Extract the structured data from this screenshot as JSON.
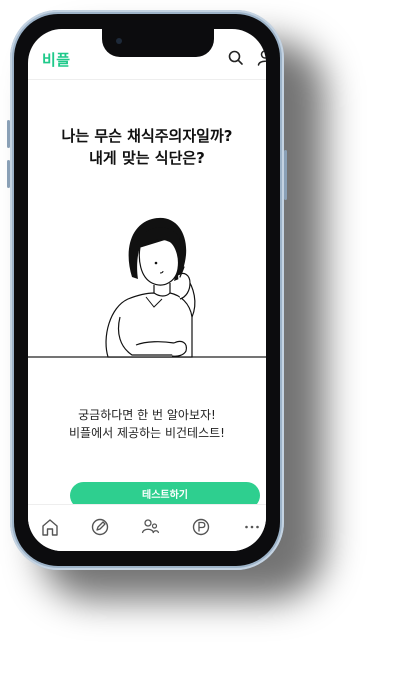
{
  "app": {
    "logo": "비플"
  },
  "header": {
    "icons": [
      "search-icon",
      "user-icon"
    ]
  },
  "main": {
    "title_line1": "나는 무슨 채식주의자일까?",
    "title_line2": "내게 맞는 식단은?",
    "subtitle_line1": "궁금하다면 한 번 알아보자!",
    "subtitle_line2": "비플에서 제공하는 비건테스트!",
    "cta_label": "테스트하기"
  },
  "tabbar": {
    "icons": [
      "home-icon",
      "edit-icon",
      "people-icon",
      "points-icon",
      "more-icon"
    ]
  },
  "colors": {
    "accent": "#2ecf8f",
    "logo": "#1ec98a",
    "frame": "#9db3c8"
  }
}
